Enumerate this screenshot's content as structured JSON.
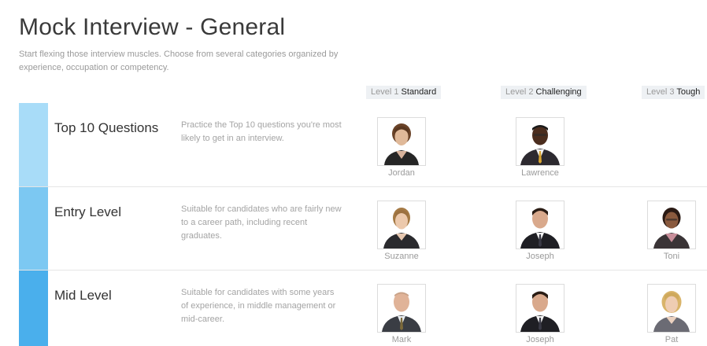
{
  "page": {
    "title": "Mock Interview - General",
    "subtitle": "Start flexing those interview muscles. Choose from several categories organized by experience, occupation or competency."
  },
  "levels": [
    {
      "prefix": "Level 1",
      "name": "Standard"
    },
    {
      "prefix": "Level 2",
      "name": "Challenging"
    },
    {
      "prefix": "Level 3",
      "name": "Tough"
    }
  ],
  "categories": [
    {
      "title": "Top 10 Questions",
      "description": "Practice the Top 10 questions you're most likely to get in an interview.",
      "stripe_color": "#a8dcf8",
      "interviewers": [
        "Jordan",
        "Lawrence"
      ]
    },
    {
      "title": "Entry Level",
      "description": "Suitable for candidates who are fairly new to a career path, including recent graduates.",
      "stripe_color": "#7cc8f2",
      "interviewers": [
        "Suzanne",
        "Joseph",
        "Toni"
      ]
    },
    {
      "title": "Mid Level",
      "description": "Suitable for candidates with some years of experience, in middle management or mid-career.",
      "stripe_color": "#4aafec",
      "interviewers": [
        "Mark",
        "Joseph",
        "Pat"
      ]
    }
  ]
}
